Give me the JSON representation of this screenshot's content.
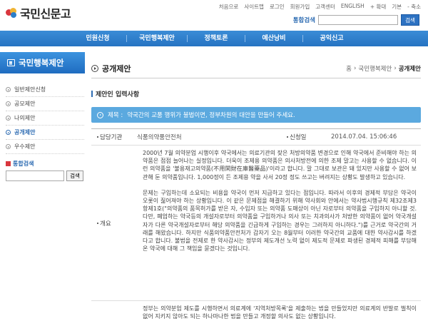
{
  "header": {
    "logo_text": "국민신문고",
    "util_links": [
      "처음으로",
      "사이트맵",
      "로그인",
      "회원가입",
      "고객센터",
      "ENGLISH",
      "+ 확대",
      "기본",
      "- 축소"
    ],
    "search": {
      "label": "통합검색",
      "button": "검색",
      "value": ""
    }
  },
  "nav": {
    "items": [
      "민원신청",
      "국민행복제안",
      "정책토론",
      "예산낭비",
      "공익신고"
    ]
  },
  "sidebar": {
    "title": "국민행복제안",
    "items": [
      {
        "label": "일반제안신청",
        "active": false
      },
      {
        "label": "공모제안",
        "active": false
      },
      {
        "label": "나의제안",
        "active": false
      },
      {
        "label": "공개제안",
        "active": true
      },
      {
        "label": "우수제안",
        "active": false
      }
    ],
    "search": {
      "label": "통합검색",
      "button": "검색"
    }
  },
  "main": {
    "title": "공개제안",
    "breadcrumb": [
      "홈",
      "국민행복제안",
      "공개제안"
    ],
    "section_title": "제안인 입력사항",
    "subject_label": "제목 :",
    "subject": "약국간의 교품 행위가 불법이면, 정부차원의 대안을 만들어 주세요.",
    "agency_label": "담당기관",
    "agency": "식품의약품안전처",
    "date_label": "신청일",
    "date": "2014.07.04. 15:06:46",
    "summary_label": "개요",
    "summary_paragraphs": [
      "2000년 7월 의약분업 시행이후 약국에서는 의료기관의 잦은 처방의약품 변경으로 인해 약국에서 준비해야 하는 의약품은 점점 늘어나는 실정입니다. 더욱이 조제용 의약품은 의사처방전에 의한 조제 말고는 사용할 수 없습니다. 이런 의약품을 '불용재고의약품(不用閑財在庫醫藥品)'이라고 합니다. 말 그대로 보관은 돼 있지만 사용할 수 없어 보관해 둔 의약품입니다. 1,000정이 든 조제용 약을 사서 20정 정도 쓰고는 버려지는 상황도 발생하고 있습니다.",
      "문제는 구입하는데 소요되는 비용을 약국이 먼저 지급하고 있다는 점입니다. 따라서 이후의 경제적 부담은 약국이 오롯이 짊어져야 하는 상황입니다. 이 같은 문제점을 해결하기 위해 약사회와 안에서는 약사법시행규칙 제32조제3항제1호(\"의약품의 품목허가를 받은 자, 수입자 또는 의약품 도매상이 아닌 자로부터 의약품을 구입하지 아니할 것. 다만, 폐업하는 약국등의 개설자로부터 의약품을 구입하거나 의사 또는 치과의사가 처방한 의약품이 없어 약국개설자가 다른 약국개설자로부터 해당 의약품을 긴급하게 구입하는 경우는 그러하지 아니하다.\")를 근거로 약국간의 거래를 해왔습니다. 하지만 식품의약품안전처가 갑자기 오는 8월부터 이러한 약국간의 교품에 대한 약사감시를 하겠다고 합니다. 불법을 전제로 한 약사감시는 정부의 제도개선 노력 없이 제도적 문제로 파생된 경제적 피해를 부담해온 약국에 대해 그 책임을 묻겠다는 것입니다.",
      "정부는 의약분업 제도를 시행하면서 의료계에 '지역처방목록'을 제출하는 법을 만들었지만 의료계의 반발로 벌칙이 없어 지키지 않아도 되는 하나마나한 법을 만들고 개정할 의사도 없는 상황입니다."
    ]
  }
}
